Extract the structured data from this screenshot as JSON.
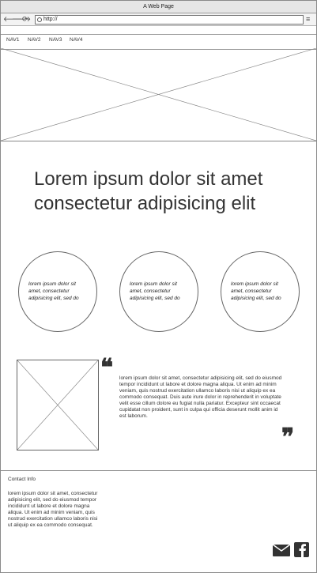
{
  "window": {
    "title": "A Web Page"
  },
  "toolbar": {
    "back_icon": "back-arrow-icon",
    "forward_icon": "forward-arrow-icon",
    "refresh_icon": "refresh-icon",
    "url": "http://",
    "menu_icon": "hamburger-menu-icon"
  },
  "nav": {
    "items": [
      "NAV1",
      "NAV2",
      "NAV3",
      "NAV4"
    ]
  },
  "main": {
    "headline": "Lorem ipsum dolor sit amet consectetur adipisicing elit",
    "circles": [
      "lorem ipsum dolor sit amet, consectetur adipisicing elit, sed do",
      "lorem ipsum dolor sit amet, consectetur adipisicing elit, sed do",
      "lorem ipsum dolor sit amet, consectetur adipisicing elit, sed do"
    ],
    "quote": "lorem ipsum dolor sit amet, consectetur adipisicing elit, sed do eiusmod tempor incididunt ut labore et dolore magna aliqua. Ut enim ad minim veniam, quis nostrud exercitation ullamco laboris nisi ut aliquip ex ea commodo consequat. Duis aute irure dolor in reprehenderit in voluptate velit esse cillum dolore eu fugiat nulla pariatur. Excepteur sint occaecat cupidatat non proident, sunt in culpa qui officia deserunt mollit anim id est laborum."
  },
  "footer": {
    "heading": "Contact Info",
    "text": "lorem ipsum dolor sit amet, consectetur adipisicing elit, sed do eiusmod tempor incididunt ut labore et dolore magna aliqua. Ut enim ad minim veniam, quis nostrud exercitation ullamco laboris nisi ut aliquip ex ea commodo consequat.",
    "icons": [
      "envelope-icon",
      "facebook-icon"
    ]
  }
}
